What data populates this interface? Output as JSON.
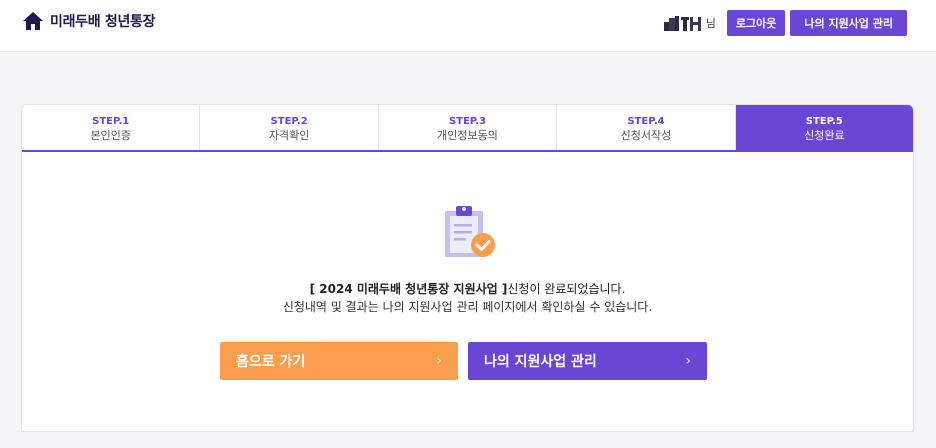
{
  "header": {
    "brand_title": "미래두배 청년통장",
    "user_suffix": "님",
    "logout_label": "로그아웃",
    "manage_label": "나의 지원사업 관리"
  },
  "steps": [
    {
      "num": "STEP.1",
      "label": "본인인증"
    },
    {
      "num": "STEP.2",
      "label": "자격확인"
    },
    {
      "num": "STEP.3",
      "label": "개인정보동의"
    },
    {
      "num": "STEP.4",
      "label": "신청서작성"
    },
    {
      "num": "STEP.5",
      "label": "신청완료"
    }
  ],
  "active_step": 5,
  "completion": {
    "program": "[ 2024 미래두배 청년통장 지원사업 ]",
    "done_text": "신청이 완료되었습니다.",
    "notice": "신청내역 및 결과는 나의 지원사업 관리 페이지에서 확인하실 수 있습니다."
  },
  "actions": {
    "home_label": "홈으로 가기",
    "manage_label": "나의 지원사업 관리",
    "chevron": "›"
  },
  "colors": {
    "primary": "#6a46d4",
    "accent_orange": "#fb9e4e",
    "brand_navy": "#1c1a4f"
  }
}
